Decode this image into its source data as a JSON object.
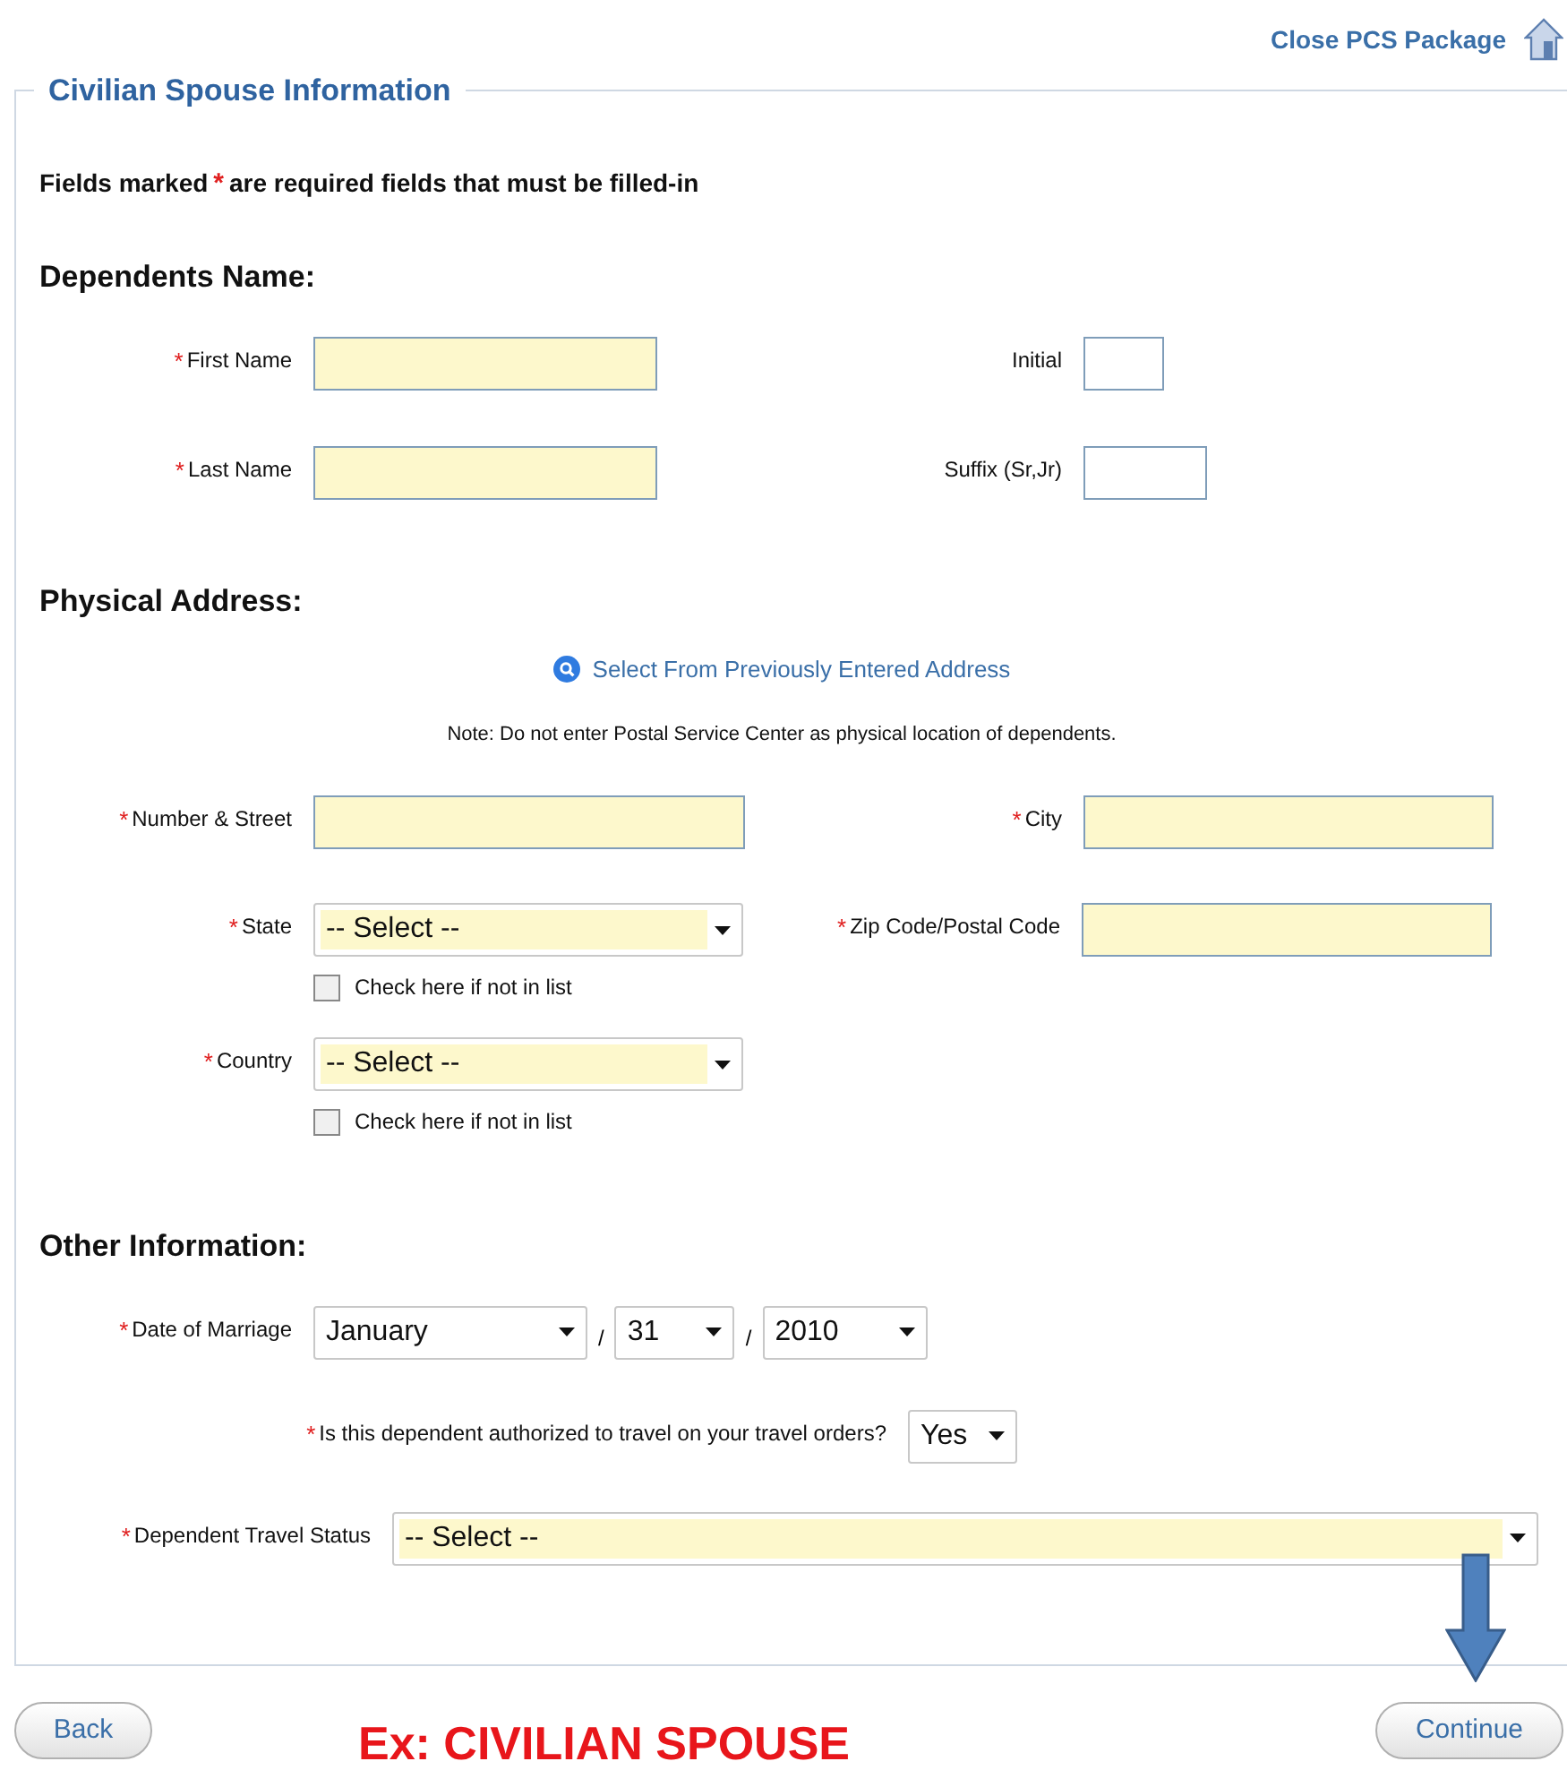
{
  "close_link": "Close PCS Package",
  "legend": "Civilian Spouse Information",
  "required_mark": "*",
  "required_note": {
    "before": "Fields marked",
    "mark": "*",
    "after": "are required fields that must be filled-in"
  },
  "dependents_name": {
    "heading": "Dependents Name:",
    "fields": [
      {
        "label": "First Name",
        "required": true
      },
      {
        "label": "Initial",
        "required": false
      },
      {
        "label": "Last Name",
        "required": true
      },
      {
        "label": "Suffix (Sr,Jr)",
        "required": false
      }
    ]
  },
  "physical_address": {
    "heading": "Physical Address:",
    "lookup_link": "Select From Previously Entered Address",
    "note": "Note: Do not enter Postal Service Center as physical location of dependents.",
    "fields": [
      {
        "kind": "text",
        "label": "Number & Street",
        "required": true
      },
      {
        "kind": "text",
        "label": "City",
        "required": true
      },
      {
        "kind": "select",
        "label": "State",
        "required": true,
        "value": "-- Select --",
        "highlighted": true,
        "not_in_list": {
          "label": "Check here if not in list",
          "checked": false
        }
      },
      {
        "kind": "text",
        "label": "Zip Code/Postal Code",
        "required": true
      },
      {
        "kind": "select",
        "label": "Country",
        "required": true,
        "value": "-- Select --",
        "highlighted": true,
        "not_in_list": {
          "label": "Check here if not in list",
          "checked": false
        }
      }
    ]
  },
  "other_information": {
    "heading": "Other Information:",
    "date_of_marriage": {
      "label": "Date of Marriage",
      "required": true,
      "month": "January",
      "day": "31",
      "year": "2010",
      "separators": [
        "/",
        "/"
      ]
    },
    "authorized": {
      "label": "Is this dependent authorized to travel on your travel orders?",
      "required": true,
      "value": "Yes",
      "highlighted": false
    },
    "travel_status": {
      "label": "Dependent Travel Status",
      "required": true,
      "value": "-- Select --",
      "highlighted": true
    }
  },
  "buttons": {
    "back": "Back",
    "continue": "Continue"
  },
  "annotation": "Ex: CIVILIAN SPOUSE"
}
